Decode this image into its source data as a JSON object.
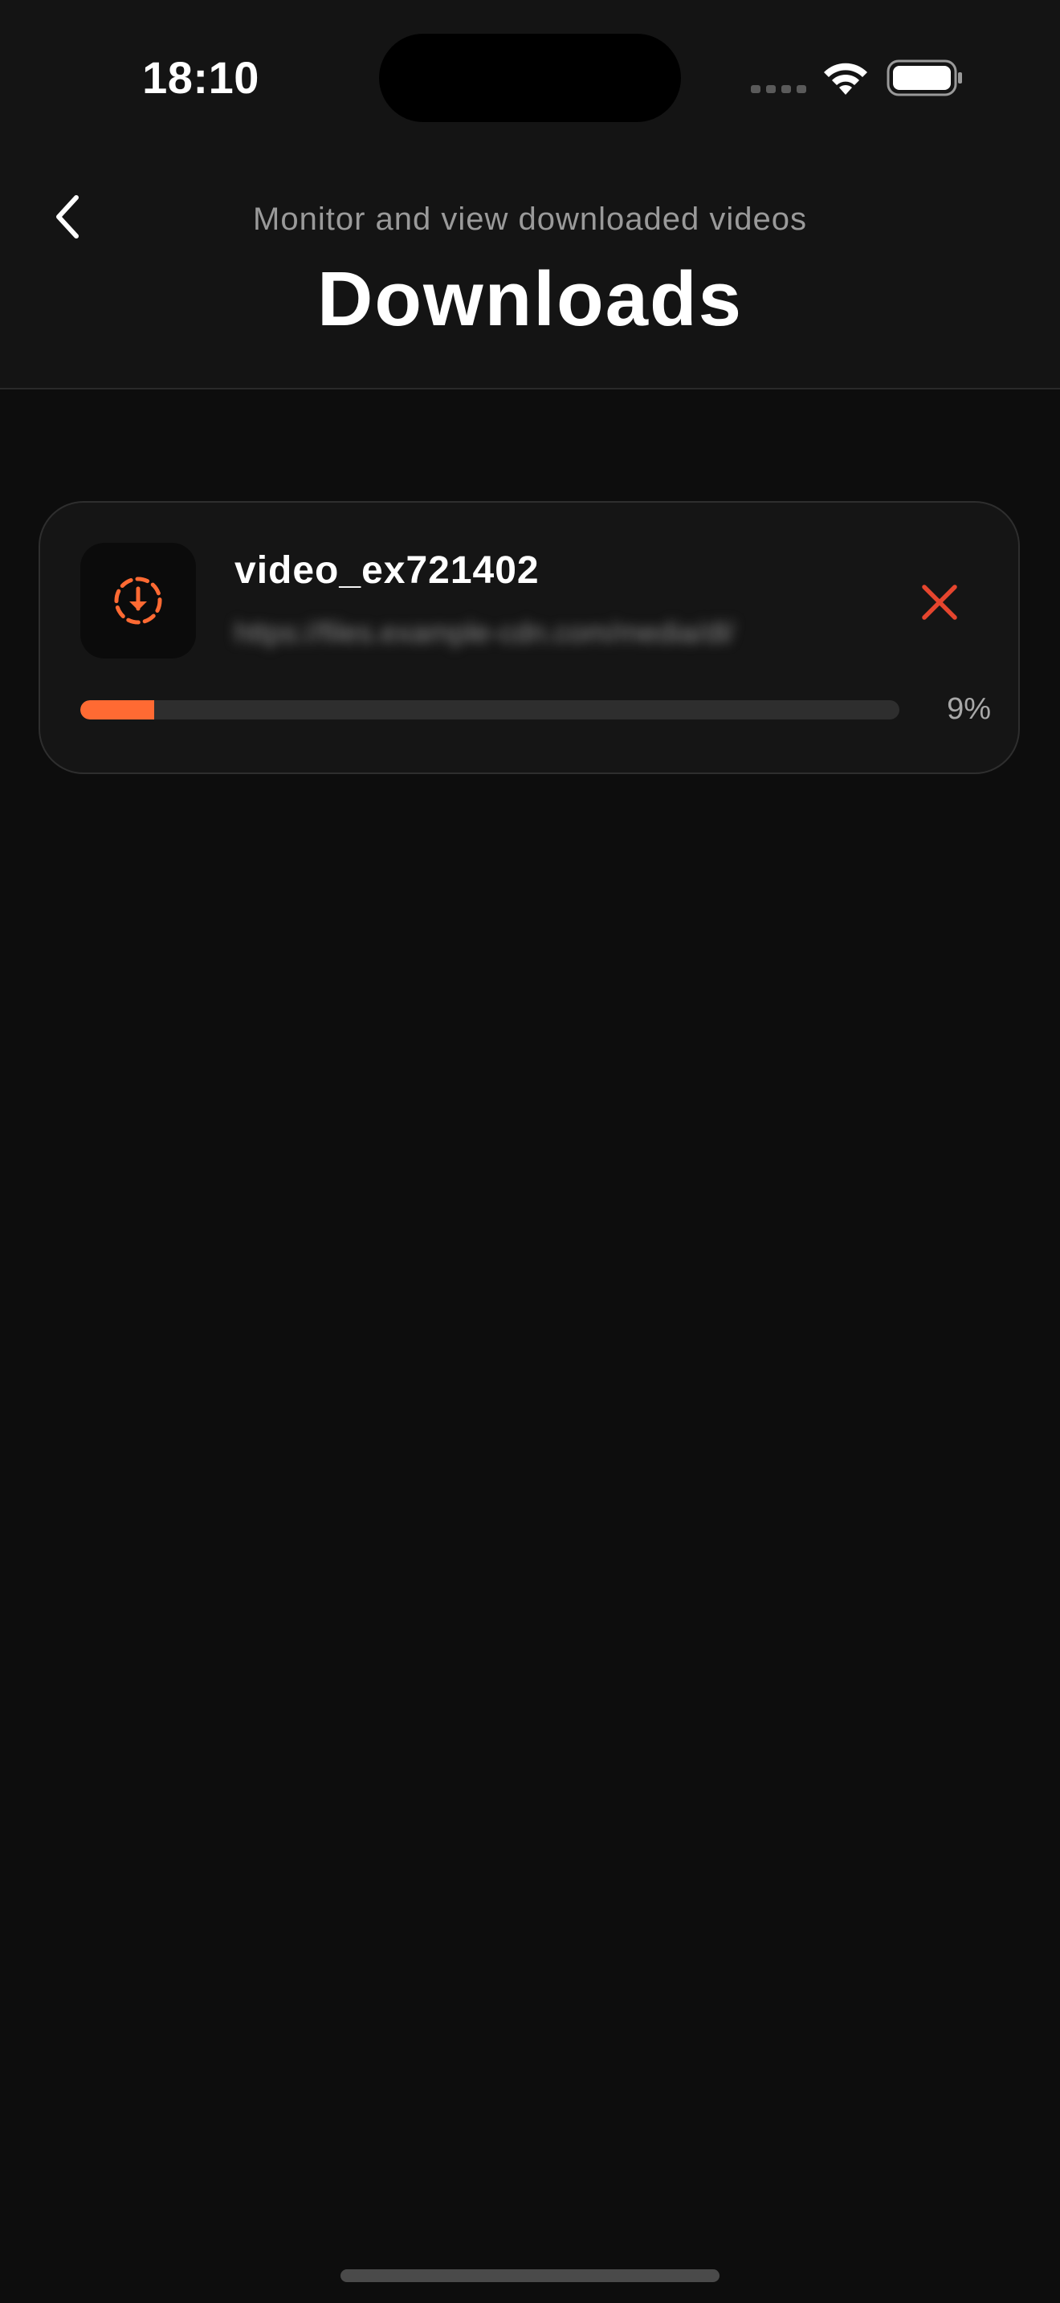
{
  "status_bar": {
    "time": "18:10",
    "icons": [
      "cellular-signal-icon",
      "wifi-icon",
      "battery-icon"
    ]
  },
  "header": {
    "back_icon": "chevron-left-icon",
    "subtitle": "Monitor and view downloaded videos",
    "title": "Downloads"
  },
  "downloads": [
    {
      "icon": "download-in-progress-icon",
      "name": "video_ex721402",
      "url": "https://files.example-cdn.com/media/dl/",
      "progress": 9,
      "progress_label": "9%",
      "cancel_icon": "close-icon"
    }
  ],
  "colors": {
    "accent": "#ff6a33",
    "cancel": "#e5452e",
    "background": "#0d0d0d",
    "card": "#151515"
  }
}
